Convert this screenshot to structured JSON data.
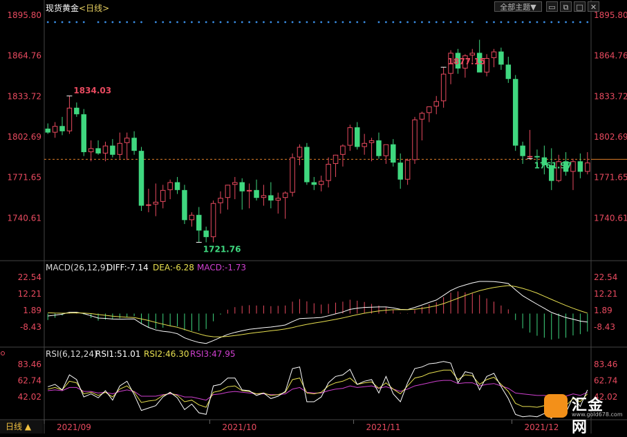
{
  "header": {
    "instrument": "现货黄金",
    "period": "<日线>",
    "theme_button": "全部主题▼"
  },
  "window_controls": [
    "minimize-icon",
    "restore-icon",
    "maximize-icon",
    "close-icon"
  ],
  "bottom_bar": {
    "period_tab": "日线 ▲"
  },
  "logo": {
    "name": "汇金网",
    "url": "www.gold678.com"
  },
  "colors": {
    "up": "#e84a5f",
    "down": "#3fd77f",
    "axis_label": "#e84a5f",
    "diff": "#ffffff",
    "dea": "#e8e050",
    "macd": "#d040d0",
    "rsi1": "#ffffff",
    "rsi2": "#e8e050",
    "rsi3": "#d040d0",
    "dash_line": "#e07f2a",
    "dots": "#3a8ee6"
  },
  "chart_data": [
    {
      "type": "candlestick",
      "title": "现货黄金 <日线>",
      "y_ticks": [
        "1895.80",
        "1864.76",
        "1833.72",
        "1802.69",
        "1771.65",
        "1740.61"
      ],
      "ylim": [
        1709,
        1895.8
      ],
      "x_ticks": [
        "2021/09",
        "2021/10",
        "2021/11",
        "2021/12"
      ],
      "annotations": [
        {
          "label": "1834.03",
          "kind": "high",
          "index": 3
        },
        {
          "label": "1721.76",
          "kind": "low",
          "index": 21
        },
        {
          "label": "1877.15",
          "kind": "high",
          "index": 55
        },
        {
          "label": "1761.97",
          "kind": "low",
          "index": 67
        }
      ],
      "current_price_line": 1785.5,
      "ohlc": [
        [
          1809,
          1813,
          1805,
          1806
        ],
        [
          1806,
          1814,
          1802,
          1811
        ],
        [
          1811,
          1818,
          1804,
          1807
        ],
        [
          1807,
          1834,
          1805,
          1825
        ],
        [
          1825,
          1829,
          1818,
          1820
        ],
        [
          1820,
          1824,
          1788,
          1791
        ],
        [
          1791,
          1800,
          1784,
          1794
        ],
        [
          1794,
          1800,
          1789,
          1790
        ],
        [
          1790,
          1799,
          1784,
          1796
        ],
        [
          1796,
          1801,
          1787,
          1789
        ],
        [
          1789,
          1806,
          1786,
          1798
        ],
        [
          1798,
          1806,
          1785,
          1802
        ],
        [
          1802,
          1807,
          1789,
          1792
        ],
        [
          1792,
          1795,
          1746,
          1750
        ],
        [
          1750,
          1763,
          1745,
          1751
        ],
        [
          1751,
          1767,
          1742,
          1753
        ],
        [
          1753,
          1766,
          1748,
          1762
        ],
        [
          1762,
          1770,
          1755,
          1768
        ],
        [
          1768,
          1772,
          1759,
          1762
        ],
        [
          1762,
          1766,
          1736,
          1739
        ],
        [
          1739,
          1745,
          1734,
          1743
        ],
        [
          1743,
          1749,
          1722,
          1731
        ],
        [
          1731,
          1734,
          1722,
          1726
        ],
        [
          1726,
          1754,
          1722,
          1752
        ],
        [
          1752,
          1761,
          1744,
          1756
        ],
        [
          1756,
          1766,
          1747,
          1766
        ],
        [
          1766,
          1772,
          1755,
          1768
        ],
        [
          1768,
          1771,
          1747,
          1761
        ],
        [
          1761,
          1767,
          1748,
          1762
        ],
        [
          1762,
          1770,
          1754,
          1756
        ],
        [
          1756,
          1766,
          1750,
          1758
        ],
        [
          1758,
          1768,
          1748,
          1754
        ],
        [
          1754,
          1760,
          1744,
          1756
        ],
        [
          1756,
          1761,
          1740,
          1760
        ],
        [
          1760,
          1790,
          1757,
          1787
        ],
        [
          1787,
          1797,
          1781,
          1795
        ],
        [
          1795,
          1798,
          1766,
          1768
        ],
        [
          1768,
          1772,
          1762,
          1766
        ],
        [
          1766,
          1773,
          1761,
          1769
        ],
        [
          1769,
          1787,
          1764,
          1782
        ],
        [
          1782,
          1789,
          1772,
          1789
        ],
        [
          1789,
          1797,
          1780,
          1796
        ],
        [
          1796,
          1812,
          1792,
          1810
        ],
        [
          1810,
          1814,
          1793,
          1795
        ],
        [
          1795,
          1805,
          1789,
          1798
        ],
        [
          1798,
          1802,
          1784,
          1800
        ],
        [
          1800,
          1806,
          1786,
          1788
        ],
        [
          1788,
          1796,
          1782,
          1797
        ],
        [
          1797,
          1801,
          1780,
          1783
        ],
        [
          1783,
          1790,
          1763,
          1770
        ],
        [
          1770,
          1786,
          1766,
          1785
        ],
        [
          1785,
          1818,
          1782,
          1816
        ],
        [
          1816,
          1822,
          1800,
          1821
        ],
        [
          1821,
          1826,
          1814,
          1826
        ],
        [
          1826,
          1834,
          1820,
          1830
        ],
        [
          1830,
          1856,
          1825,
          1851
        ],
        [
          1851,
          1869,
          1843,
          1867
        ],
        [
          1867,
          1870,
          1851,
          1855
        ],
        [
          1855,
          1866,
          1848,
          1865
        ],
        [
          1865,
          1870,
          1860,
          1867
        ],
        [
          1867,
          1877,
          1853,
          1852
        ],
        [
          1852,
          1866,
          1849,
          1863
        ],
        [
          1863,
          1870,
          1856,
          1868
        ],
        [
          1868,
          1871,
          1854,
          1858
        ],
        [
          1858,
          1864,
          1844,
          1847
        ],
        [
          1847,
          1850,
          1792,
          1796
        ],
        [
          1796,
          1799,
          1782,
          1788
        ],
        [
          1788,
          1808,
          1786,
          1788
        ],
        [
          1788,
          1793,
          1781,
          1787
        ],
        [
          1787,
          1796,
          1774,
          1781
        ],
        [
          1781,
          1794,
          1762,
          1769
        ],
        [
          1769,
          1789,
          1768,
          1784
        ],
        [
          1784,
          1791,
          1773,
          1776
        ],
        [
          1776,
          1786,
          1762,
          1784
        ],
        [
          1784,
          1790,
          1771,
          1776
        ],
        [
          1776,
          1791,
          1774,
          1783
        ]
      ]
    },
    {
      "type": "bar+line",
      "title": "MACD(26,12,9)",
      "legend": {
        "diff": "DIFF:-7.14",
        "dea": "DEA:-6.28",
        "macd": "MACD:-1.73"
      },
      "y_ticks": [
        "22.54",
        "12.21",
        "1.89",
        "-8.43"
      ],
      "ylim": [
        -20,
        26
      ],
      "diff": [
        -1.5,
        -1,
        -0.4,
        0.8,
        0.8,
        0,
        -1.4,
        -2.8,
        -3,
        -3.4,
        -3.5,
        -3.4,
        -3.3,
        -6.3,
        -8.6,
        -10.2,
        -11,
        -11.5,
        -12.5,
        -15.1,
        -16.7,
        -18,
        -18.6,
        -16.8,
        -14.8,
        -13,
        -11.7,
        -10.7,
        -9.8,
        -9.3,
        -8.8,
        -8.4,
        -7.8,
        -7.1,
        -5,
        -3.1,
        -2.9,
        -2.7,
        -2.4,
        -1.4,
        -0.2,
        1,
        2.6,
        3.3,
        3.8,
        4,
        4.1,
        4.1,
        3.5,
        2.6,
        2.5,
        3.8,
        5.3,
        6.9,
        8.4,
        11.3,
        14.3,
        16.4,
        17.8,
        19.1,
        20,
        20,
        19.9,
        19.4,
        18.7,
        14.8,
        11.1,
        8.4,
        5.8,
        3.3,
        0.7,
        -0.9,
        -2.5,
        -3.5,
        -4.7,
        -5.3
      ],
      "dea": [
        0.5,
        0.3,
        0.2,
        0.3,
        0.4,
        0.3,
        0,
        -0.6,
        -1.1,
        -1.6,
        -2,
        -2.3,
        -2.5,
        -3.3,
        -4.3,
        -5.5,
        -6.6,
        -7.6,
        -8.5,
        -9.9,
        -11.3,
        -12.6,
        -13.8,
        -14.4,
        -14.5,
        -14.2,
        -13.7,
        -13.1,
        -12.4,
        -11.8,
        -11.3,
        -10.7,
        -10.2,
        -9.6,
        -8.7,
        -7.6,
        -6.7,
        -5.9,
        -5.2,
        -4.4,
        -3.6,
        -2.7,
        -1.7,
        -0.7,
        0.2,
        1,
        1.6,
        2.1,
        2.4,
        2.4,
        2.4,
        2.7,
        3.2,
        4,
        4.9,
        6.2,
        7.8,
        9.5,
        11.2,
        12.8,
        14.2,
        15.3,
        16.2,
        16.9,
        17.4,
        16.8,
        15.7,
        14.3,
        12.7,
        10.8,
        8.8,
        6.9,
        5,
        3.3,
        1.7,
        0.3
      ]
    },
    {
      "type": "line",
      "title": "RSI(6,12,24)",
      "legend": {
        "rsi1": "RSI1:51.01",
        "rsi2": "RSI2:46.30",
        "rsi3": "RSI3:47.95"
      },
      "y_ticks": [
        "83.46",
        "62.74",
        "42.02"
      ],
      "ylim": [
        15,
        92
      ],
      "rsi1": [
        55,
        58,
        51,
        70,
        64,
        42,
        46,
        41,
        50,
        38,
        56,
        62,
        45,
        25,
        28,
        31,
        42,
        48,
        41,
        26,
        33,
        22,
        20,
        56,
        58,
        66,
        66,
        51,
        50,
        44,
        47,
        40,
        43,
        49,
        78,
        80,
        36,
        36,
        42,
        60,
        68,
        70,
        77,
        58,
        62,
        64,
        47,
        68,
        46,
        36,
        60,
        78,
        80,
        84,
        85,
        87,
        85,
        60,
        74,
        72,
        51,
        68,
        72,
        55,
        40,
        20,
        17,
        18,
        17,
        21,
        15,
        33,
        22,
        42,
        30,
        51
      ],
      "rsi2": [
        52,
        54,
        51,
        62,
        60,
        46,
        48,
        44,
        48,
        42,
        52,
        56,
        48,
        35,
        37,
        38,
        44,
        47,
        44,
        36,
        38,
        32,
        29,
        48,
        50,
        55,
        56,
        50,
        49,
        46,
        47,
        44,
        45,
        48,
        64,
        66,
        47,
        46,
        48,
        56,
        60,
        62,
        66,
        58,
        60,
        61,
        53,
        60,
        52,
        46,
        56,
        66,
        68,
        72,
        74,
        76,
        76,
        64,
        70,
        69,
        58,
        64,
        67,
        58,
        49,
        34,
        30,
        30,
        29,
        31,
        27,
        36,
        31,
        40,
        36,
        46
      ],
      "rsi3": [
        50,
        51,
        50,
        54,
        54,
        49,
        49,
        47,
        48,
        46,
        49,
        51,
        49,
        43,
        43,
        43,
        45,
        46,
        45,
        42,
        42,
        40,
        38,
        45,
        46,
        48,
        49,
        48,
        47,
        46,
        46,
        45,
        45,
        46,
        52,
        54,
        48,
        47,
        47,
        50,
        52,
        53,
        56,
        54,
        55,
        56,
        53,
        55,
        52,
        49,
        52,
        56,
        58,
        60,
        62,
        63,
        63,
        59,
        60,
        60,
        56,
        58,
        59,
        56,
        53,
        47,
        46,
        45,
        44,
        44,
        43,
        45,
        43,
        46,
        44,
        48
      ]
    }
  ]
}
